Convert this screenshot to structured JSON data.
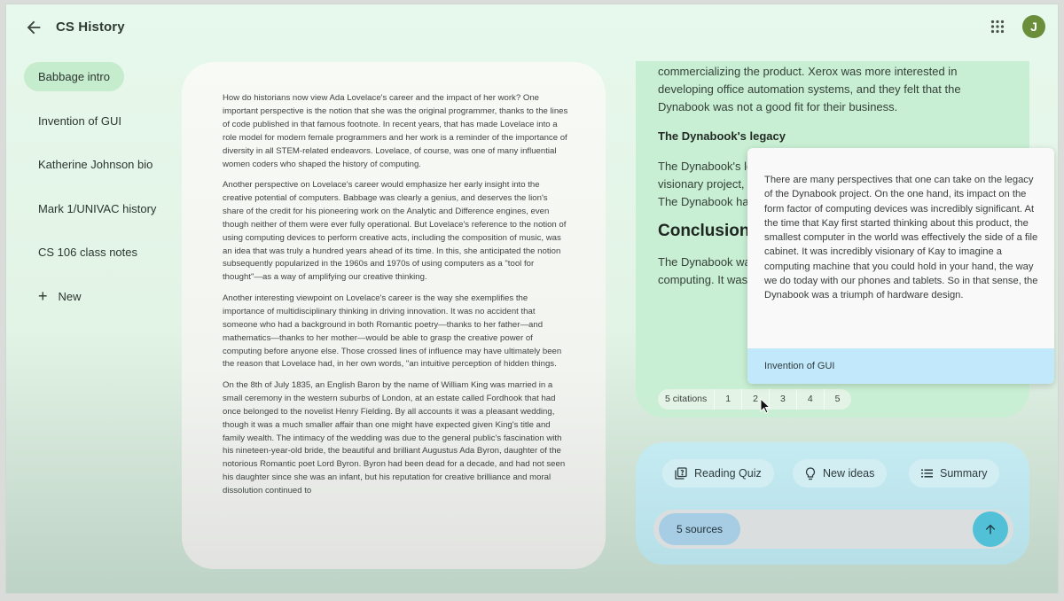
{
  "header": {
    "title": "CS History",
    "avatar_letter": "J",
    "back_icon": "arrow-left-icon",
    "apps_icon": "apps-grid-icon"
  },
  "sidebar": {
    "items": [
      {
        "label": "Babbage intro",
        "active": true
      },
      {
        "label": "Invention of GUI",
        "active": false
      },
      {
        "label": "Katherine Johnson bio",
        "active": false
      },
      {
        "label": "Mark 1/UNIVAC history",
        "active": false
      },
      {
        "label": "CS 106 class notes",
        "active": false
      }
    ],
    "new_label": "New",
    "new_icon": "plus-icon"
  },
  "document": {
    "paragraphs": [
      "How do historians now view Ada Lovelace's career and the impact of her work? One important perspective is the notion that she was the original programmer, thanks to the lines of code published in that famous footnote. In recent years, that has made Lovelace into a role model for modern female programmers and her work is a reminder of the importance of diversity in all STEM-related endeavors. Lovelace, of course, was one of many influential women coders who shaped the history of computing.",
      "Another perspective on Lovelace's career would emphasize her early insight into the creative potential of computers. Babbage was clearly a genius, and deserves the lion's share of the credit for his pioneering work on the Analytic and Difference engines, even though neither of them were ever fully operational. But Lovelace's reference to the notion of using computing devices to perform creative acts, including the composition of music, was an idea that was truly a hundred years ahead of its time. In this, she anticipated the notion subsequently popularized in the 1960s and 1970s of using computers as a \"tool for thought\"—as a way of amplifying our creative thinking.",
      "Another interesting viewpoint on Lovelace's career is the way she exemplifies the importance of multidisciplinary thinking in driving innovation. It was no accident that someone who had a background in both Romantic poetry—thanks to her father—and mathematics—thanks to her mother—would be able to grasp the creative power of computing before anyone else. Those crossed lines of influence may have ultimately been the reason that Lovelace had, in her own words, \"an intuitive perception of hidden things.",
      "On the 8th of July 1835, an English Baron by the name of William King was married in a small ceremony in the western suburbs of London, at an estate called Fordhook that had once belonged to the novelist Henry Fielding. By all accounts it was a pleasant wedding, though it was a much smaller affair than one might have expected given King's title and family wealth. The intimacy of the wedding was due to the general public's fascination with his nineteen-year-old bride, the beautiful and brilliant Augustus Ada Byron, daughter of the notorious Romantic poet Lord Byron. Byron had been dead for a decade, and had not seen his daughter since she was an infant, but his reputation for creative brilliance and moral dissolution continued to"
    ]
  },
  "note": {
    "intro_paragraph": "commercializing the product. Xerox was more interested in developing office automation systems, and they felt that the Dynabook was not a good fit for their business.",
    "legacy_heading": "The Dynabook's legacy",
    "legacy_paragraph": "The Dynabook's legacy is debated. Some believe that it was a visionary project, while others believe it never lived up to its potential. The Dynabook had a lasting influence on personal computers.",
    "conclusion_heading": "Conclusion",
    "conclusion_paragraph": "The Dynabook was an influential project on the development of computing. It was never released to the public but left a legacy.",
    "citations_label": "5 citations",
    "citations": [
      "1",
      "2",
      "3",
      "4",
      "5"
    ]
  },
  "citation_popup": {
    "text": "There are many perspectives that one can take on the legacy of the Dynabook project. On the one hand, its impact on the form factor of computing devices was incredibly significant. At the time that Kay first started thinking about this product, the smallest computer in the world was effectively the side of a file cabinet. It was incredibly visionary of Kay to imagine a computing machine that you could hold in your hand, the way we do today with our phones and tablets. So in that sense, the Dynabook was a triumph of hardware design.",
    "source": "Invention of GUI"
  },
  "composer": {
    "chips": [
      {
        "label": "Reading Quiz",
        "icon": "quiz-icon"
      },
      {
        "label": "New ideas",
        "icon": "lightbulb-icon"
      },
      {
        "label": "Summary",
        "icon": "list-icon"
      }
    ],
    "sources_label": "5 sources",
    "send_icon": "arrow-up-icon"
  },
  "colors": {
    "sidebar_active": "#c6ecce",
    "note_bg": "#c8efd3",
    "popup_footer": "#c2e9fb",
    "send_button": "#52c1d8",
    "avatar": "#6b8e3a"
  }
}
